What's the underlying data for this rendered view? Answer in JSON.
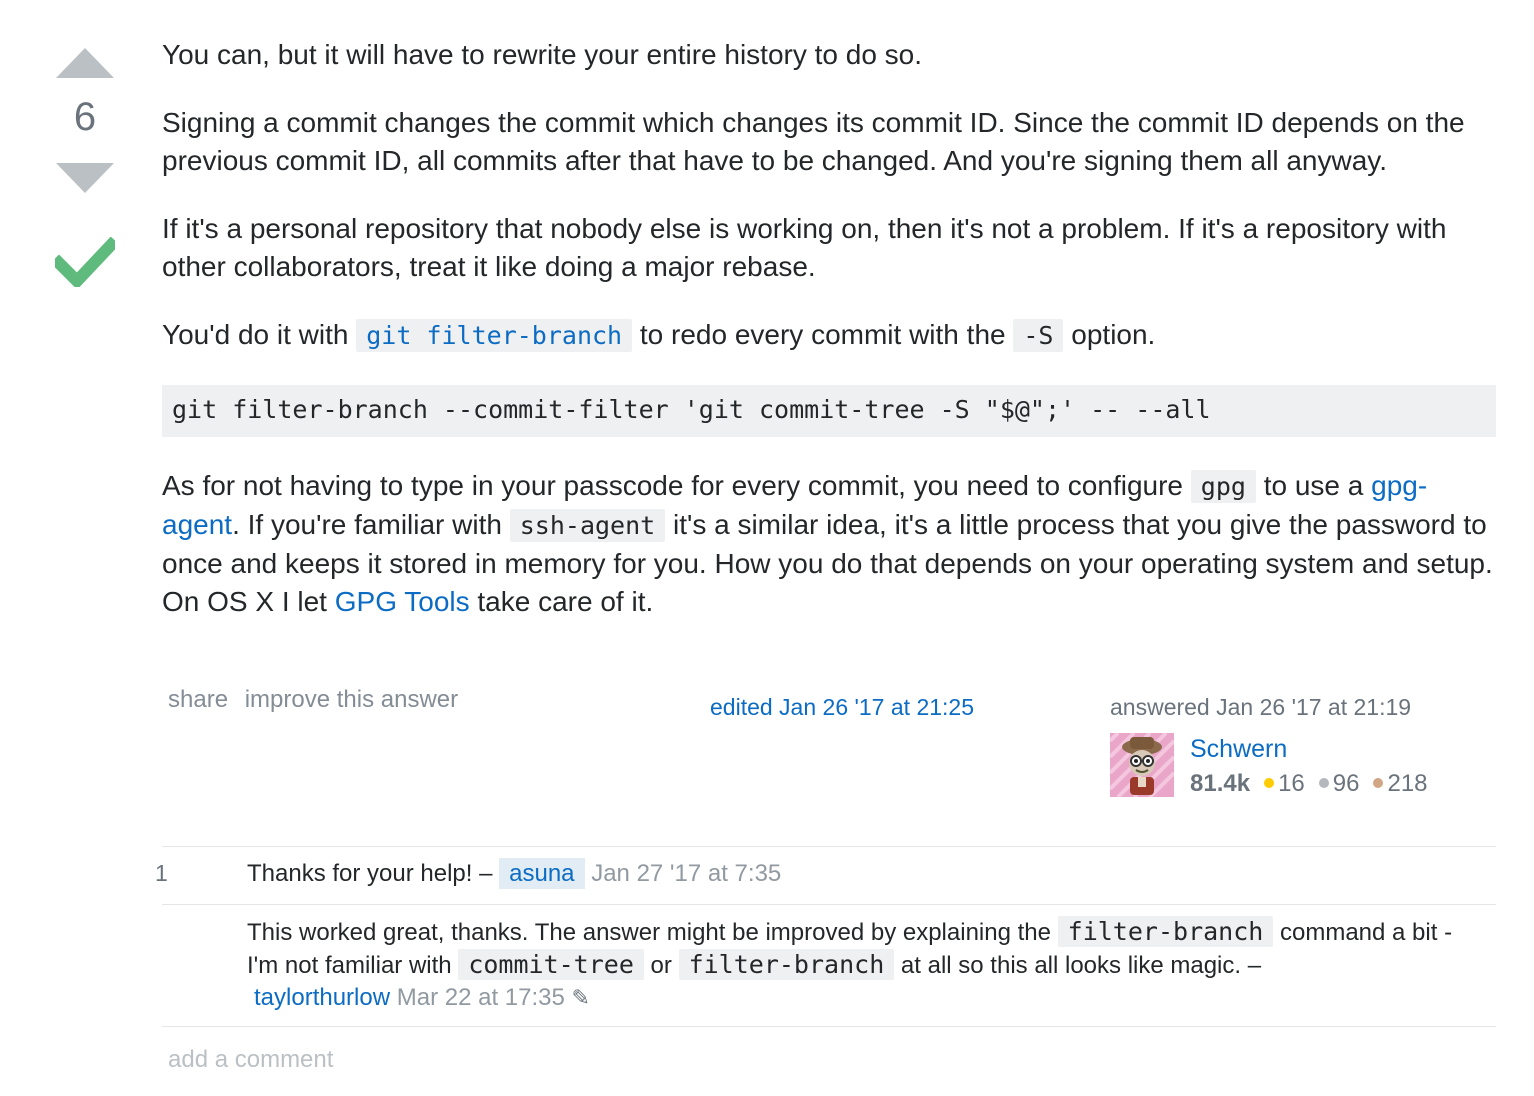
{
  "answer": {
    "vote_count": "6",
    "paragraphs": {
      "p1": "You can, but it will have to rewrite your entire history to do so.",
      "p2": "Signing a commit changes the commit which changes its commit ID. Since the commit ID depends on the previous commit ID, all commits after that have to be changed. And you're signing them all anyway.",
      "p3": "If it's a personal repository that nobody else is working on, then it's not a problem. If it's a repository with other collaborators, treat it like doing a major rebase.",
      "p4_before": "You'd do it with ",
      "p4_code1": "git filter-branch",
      "p4_mid": " to redo every commit with the ",
      "p4_code2": "-S",
      "p4_after": " option.",
      "code_block": "git filter-branch --commit-filter 'git commit-tree -S \"$@\";' -- --all",
      "p5_a": "As for not having to type in your passcode for every commit, you need to configure ",
      "p5_code1": "gpg",
      "p5_b": " to use a ",
      "p5_link1": "gpg-agent",
      "p5_c": ". If you're familiar with ",
      "p5_code2": "ssh-agent",
      "p5_d": " it's a similar idea, it's a little process that you give the password to once and keeps it stored in memory for you. How you do that depends on your operating system and setup. On OS X I let ",
      "p5_link2": "GPG Tools",
      "p5_e": " take care of it."
    },
    "menu": {
      "share": "share",
      "improve": "improve this answer"
    },
    "edited": "edited Jan 26 '17 at 21:25",
    "answered": "answered Jan 26 '17 at 21:19",
    "user": {
      "name": "Schwern",
      "reputation": "81.4k",
      "gold": "16",
      "silver": "96",
      "bronze": "218"
    },
    "colors": {
      "accepted": "#5eba7d",
      "link": "#0c6cc4",
      "gold": "#ffcc01",
      "silver": "#b4b8bc",
      "bronze": "#d1a684"
    }
  },
  "comments": [
    {
      "score": "1",
      "text": "Thanks for your help! – ",
      "user": "asuna",
      "date": "Jan 27 '17 at 7:35"
    },
    {
      "text_a": "This worked great, thanks. The answer might be improved by explaining the ",
      "code1": "filter-branch",
      "text_b": " command a bit - I'm not familiar with ",
      "code2": "commit-tree",
      "text_c": " or ",
      "code3": "filter-branch",
      "text_d": " at all so this all looks like magic. – ",
      "user": "taylorthurlow",
      "date": "Mar 22 at 17:35",
      "edit_icon": "pencil-icon"
    }
  ],
  "add_comment": "add a comment"
}
